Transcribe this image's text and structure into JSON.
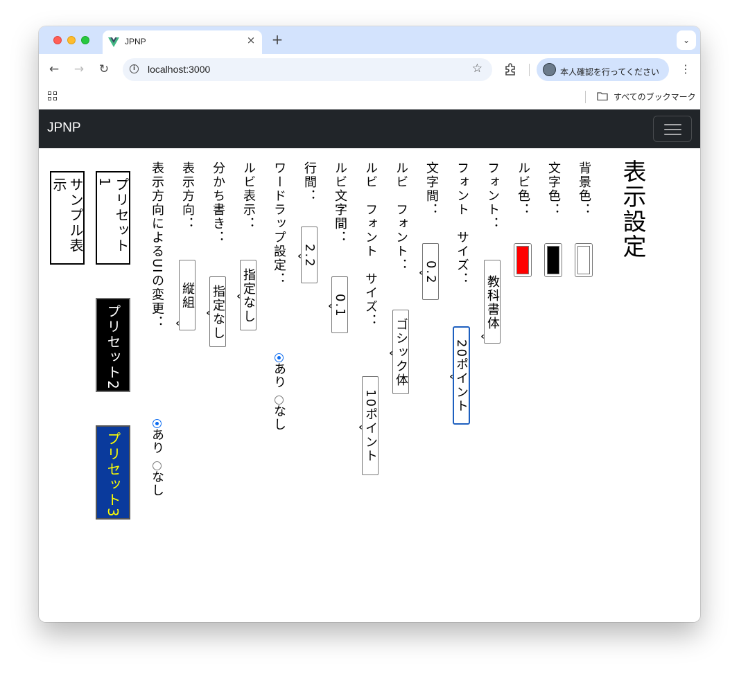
{
  "browser": {
    "tab_title": "JPNP",
    "tab_close": "×",
    "new_tab": "+",
    "tab_menu": "⌄",
    "url": "localhost:3000",
    "profile_label": "本人確認を行ってください",
    "bookmarks_label": "すべてのブックマーク",
    "nav": {
      "back": "←",
      "forward": "→",
      "reload": "↻",
      "star": "☆",
      "kebab": "⋮"
    }
  },
  "app": {
    "brand": "JPNP",
    "heading": "表示設定",
    "labels": {
      "background_color": "背景色：",
      "text_color": "文字色：",
      "ruby_color": "ルビ色：",
      "font": "フォント：",
      "font_size": "フォント　サイズ：",
      "letter_spacing": "文字間：",
      "ruby_font": "ルビ　フォント：",
      "ruby_font_size": "ルビ　フォント　サイズ：",
      "ruby_letter_spacing": "ルビ文字間：",
      "line_spacing": "行間：",
      "word_wrap": "ワードラップ設定：",
      "ruby_display": "ルビ表示：",
      "word_separation": "分かち書き：",
      "direction": "表示方向：",
      "ui_by_direction": "表示方向によるUIの変更："
    },
    "values": {
      "font": "教科書体",
      "font_size": "20ポイント",
      "letter_spacing": "0.2",
      "ruby_font": "ゴシック体",
      "ruby_font_size": "10ポイント",
      "ruby_letter_spacing": "0.1",
      "line_spacing": "2.2",
      "ruby_display": "指定なし",
      "word_separation": "指定なし",
      "direction": "縦組"
    },
    "radio": {
      "yes": "あり",
      "no": "なし"
    },
    "colors": {
      "background": "#ffffff",
      "text": "#000000",
      "ruby": "#ff0000",
      "preset2_bg": "#000000",
      "preset2_fg": "#ffffff",
      "preset3_bg": "#0a3a9c",
      "preset3_fg": "#ffff00"
    },
    "presets": {
      "preset1": "プリセット1",
      "preset2": "プリセット2",
      "preset3": "プリセット3",
      "sample": "サンプル表示"
    }
  }
}
